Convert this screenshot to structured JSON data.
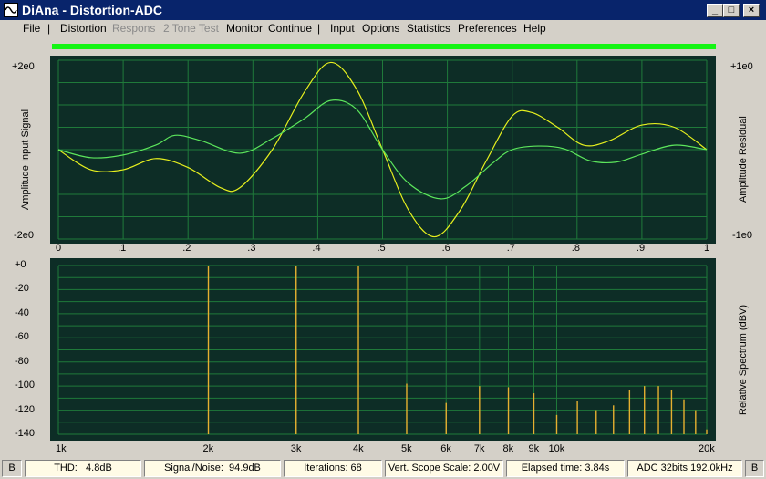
{
  "window": {
    "title": "DiAna - Distortion-ADC",
    "controls": {
      "minimize": "_",
      "maximize": "□",
      "close": "×"
    }
  },
  "menu": {
    "items": [
      {
        "label": "File",
        "enabled": true
      },
      {
        "label": "|",
        "separator": true
      },
      {
        "label": "Distortion",
        "enabled": true
      },
      {
        "label": "Respons",
        "enabled": false
      },
      {
        "label": "2 Tone Test",
        "enabled": false
      },
      {
        "label": "Monitor",
        "enabled": true
      },
      {
        "label": "Continue",
        "enabled": true
      },
      {
        "label": "|",
        "separator": true
      },
      {
        "label": "Input",
        "enabled": true
      },
      {
        "label": "Options",
        "enabled": true
      },
      {
        "label": "Statistics",
        "enabled": true
      },
      {
        "label": "Preferences",
        "enabled": true
      },
      {
        "label": "Help",
        "enabled": true
      }
    ]
  },
  "colors": {
    "plot_bg": "#0d2d26",
    "grid": "#1f7a3a",
    "signal": "#e6f01e",
    "residual": "#5ce65c",
    "spectrum": "#e6b030",
    "level_bar": "#14f514"
  },
  "scope": {
    "ylabel_left": "Amplitude Input Signal",
    "ylabel_right": "Amplitude Residual",
    "left_top": "+2e0",
    "left_bottom": "-2e0",
    "right_top": "+1e0",
    "right_bottom": "-1e0",
    "x_ticks": [
      "0",
      ".1",
      ".2",
      ".3",
      ".4",
      ".5",
      ".6",
      ".7",
      ".8",
      ".9",
      "1"
    ]
  },
  "spectrum": {
    "ylabel_right": "Relative Spectrum (dBV)",
    "y_ticks": [
      "+0",
      "-20",
      "-40",
      "-60",
      "-80",
      "-100",
      "-120",
      "-140"
    ],
    "x_ticks": [
      "1k",
      "2k",
      "3k",
      "4k",
      "5k",
      "6k",
      "7k",
      "8k",
      "9k",
      "10k",
      "20k"
    ]
  },
  "chart_data": [
    {
      "type": "line",
      "title": "",
      "xlabel": "",
      "ylabel": "Amplitude Input Signal",
      "xlim": [
        0,
        1
      ],
      "ylim": [
        -2,
        2
      ],
      "series": [
        {
          "name": "",
          "x": [
            0,
            0.05,
            0.1,
            0.15,
            0.2,
            0.25,
            0.28,
            0.33,
            0.38,
            0.42,
            0.46,
            0.5,
            0.54,
            0.58,
            0.62,
            0.66,
            0.7,
            0.73,
            0.77,
            0.81,
            0.85,
            0.9,
            0.95,
            1.0
          ],
          "y": [
            0,
            -0.45,
            -0.45,
            -0.2,
            -0.4,
            -0.85,
            -0.85,
            0.0,
            1.3,
            1.95,
            1.35,
            0.0,
            -1.35,
            -1.95,
            -1.35,
            -0.25,
            0.75,
            0.83,
            0.5,
            0.1,
            0.2,
            0.55,
            0.5,
            0.0
          ]
        },
        {
          "name": "",
          "x": [
            0,
            0.05,
            0.1,
            0.15,
            0.18,
            0.22,
            0.28,
            0.33,
            0.38,
            0.42,
            0.46,
            0.5,
            0.54,
            0.59,
            0.63,
            0.67,
            0.7,
            0.74,
            0.78,
            0.82,
            0.86,
            0.9,
            0.95,
            1.0
          ],
          "y": [
            0,
            -0.18,
            -0.12,
            0.1,
            0.32,
            0.2,
            -0.08,
            0.25,
            0.7,
            1.1,
            0.9,
            0.0,
            -0.75,
            -1.1,
            -0.8,
            -0.3,
            0.0,
            0.08,
            0.02,
            -0.25,
            -0.28,
            -0.1,
            0.1,
            0.0
          ]
        }
      ]
    },
    {
      "type": "bar",
      "title": "",
      "xlabel": "",
      "ylabel": "Relative Spectrum (dBV)",
      "x_scale": "log",
      "xlim": [
        1000,
        20000
      ],
      "ylim": [
        -140,
        0
      ],
      "x": [
        2000,
        3000,
        4000,
        5000,
        6000,
        7000,
        8000,
        9000,
        10000,
        11000,
        12000,
        13000,
        14000,
        15000,
        16000,
        17000,
        18000,
        19000,
        20000
      ],
      "values": [
        0,
        0,
        0,
        -98,
        -114,
        -100,
        -101,
        -106,
        -124,
        -112,
        -120,
        -116,
        -103,
        -100,
        -100,
        -103,
        -111,
        -120,
        -136
      ]
    }
  ],
  "status": {
    "b_left": "B",
    "thd_label": "THD:",
    "thd_value": "4.8dB",
    "snr_label": "Signal/Noise:",
    "snr_value": "94.9dB",
    "iterations": "Iterations: 68",
    "scope_scale": "Vert. Scope Scale: 2.00V",
    "elapsed": "Elapsed time: 3.84s",
    "adc": "ADC 32bits 192.0kHz",
    "b_right": "B"
  }
}
